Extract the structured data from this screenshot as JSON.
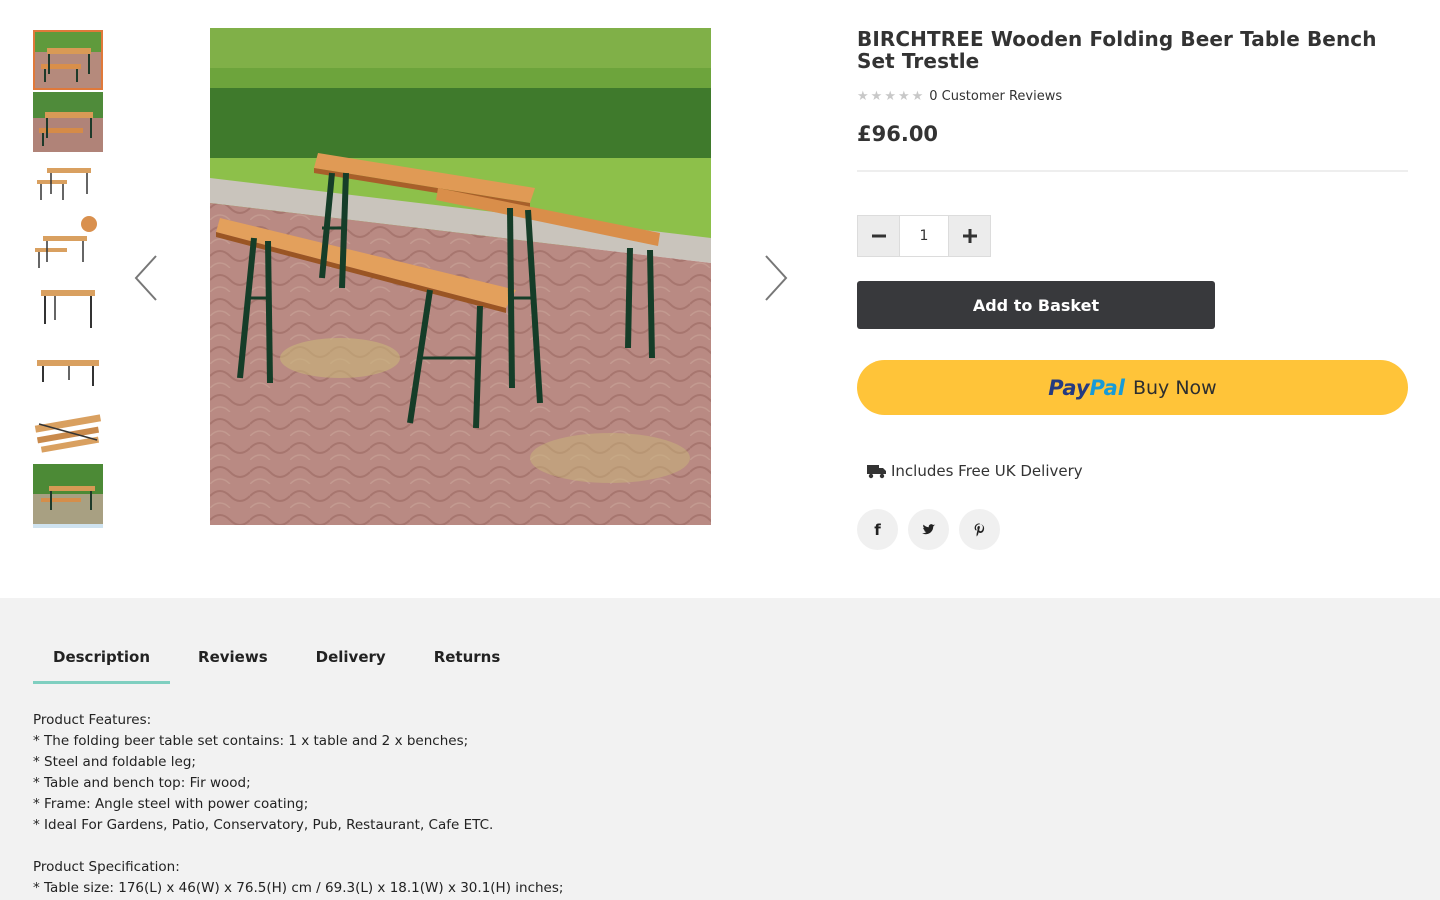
{
  "product": {
    "title": "BIRCHTREE Wooden Folding Beer Table Bench Set Trestle",
    "rating": 0,
    "rating_max": 5,
    "reviews_text": "0 Customer Reviews",
    "price": "£96.00"
  },
  "gallery": {
    "thumbnail_count": 8,
    "active_index": 0
  },
  "quantity": {
    "value": "1"
  },
  "buttons": {
    "add_to_basket": "Add to Basket",
    "paypal_pay": "Pay",
    "paypal_pal": "Pal",
    "paypal_buy_now": "Buy Now"
  },
  "delivery": {
    "text": "Includes Free UK Delivery"
  },
  "social": {
    "facebook": "f"
  },
  "tabs": [
    {
      "label": "Description"
    },
    {
      "label": "Reviews"
    },
    {
      "label": "Delivery"
    },
    {
      "label": "Returns"
    }
  ],
  "description": {
    "features_heading": "Product Features:",
    "features": [
      "* The folding beer table set contains: 1 x table and 2 x benches;",
      "* Steel and foldable leg;",
      "* Table and bench top: Fir wood;",
      "* Frame: Angle steel with power coating;",
      "* Ideal For Gardens, Patio, Conservatory, Pub, Restaurant, Cafe ETC."
    ],
    "spec_heading": "Product Specification:",
    "specs": [
      "* Table size: 176(L) x 46(W) x 76.5(H) cm / 69.3(L) x 18.1(W) x 30.1(H) inches;"
    ]
  },
  "colors": {
    "dark_button": "#38393c",
    "paypal_yellow": "#ffc439",
    "tab_underline": "#7fcfc0",
    "thumb_active": "#e0793a"
  }
}
